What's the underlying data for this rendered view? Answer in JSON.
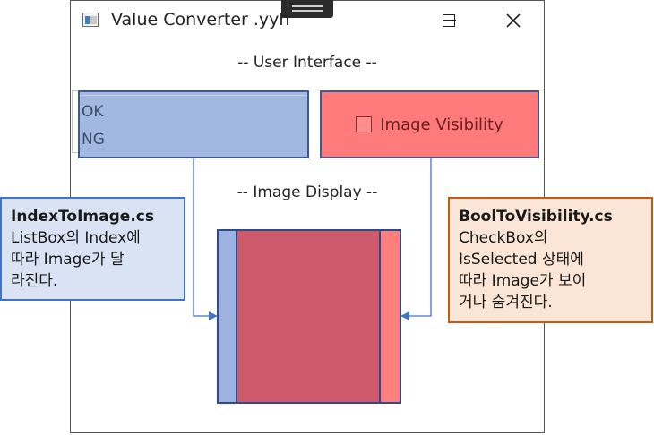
{
  "window": {
    "title": "Value Converter .yyh",
    "icon": "app-window-icon",
    "controls": {
      "minimize_icon": "minimize-icon",
      "maximize_icon": "maximize-icon",
      "close_icon": "close-icon"
    }
  },
  "sections": {
    "user_interface": "-- User Interface --",
    "image_display": "-- Image Display --"
  },
  "listbox": {
    "items": [
      {
        "label": "OK"
      },
      {
        "label": "NG"
      }
    ]
  },
  "checkbox": {
    "label": "Image Visibility",
    "checked": false
  },
  "callouts": {
    "left": {
      "title": "IndexToImage.cs",
      "lines": [
        "ListBox의 Index에",
        "따라 Image가 달",
        "라진다."
      ]
    },
    "right": {
      "title": "BoolToVisibility.cs",
      "lines": [
        "CheckBox의",
        "IsSelected 상태에",
        "따라 Image가 보이",
        "거나 숨겨진다."
      ]
    }
  },
  "colors": {
    "listbox_fill": "#a3b8e0",
    "checkbox_fill": "#ff7a7a",
    "image_fill": "#cf5a6c",
    "connector": "#4472c4"
  }
}
